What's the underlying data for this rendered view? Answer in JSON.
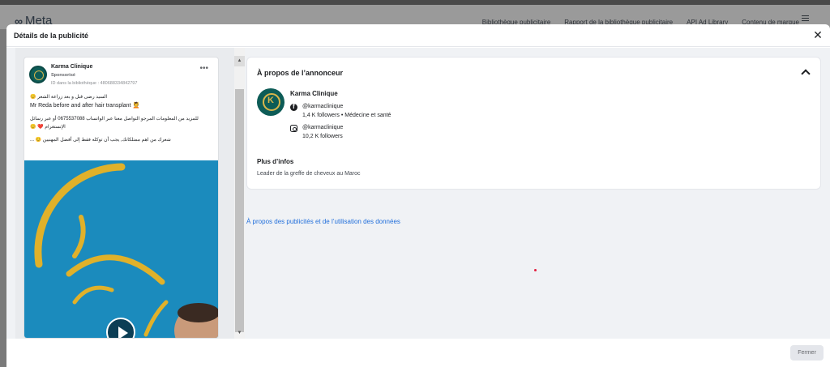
{
  "background": {
    "logo_word": "Meta",
    "nav": [
      "Bibliothèque publicitaire",
      "Rapport de la bibliothèque publicitaire",
      "API Ad Library",
      "Contenu de marque"
    ]
  },
  "modal": {
    "title": "Détails de la publicité",
    "close_label": "Fermer"
  },
  "ad": {
    "page_name": "Karma Clinique",
    "sponsored": "Sponsorisé",
    "library_id": "ID dans la bibliothèque : 480688334842797",
    "text_lines": [
      "السيد رضى قبل و بعد زراعة الشعر 😊",
      "Mr Reda before and after hair transplant 💆",
      "للمزيد من المعلومات المرجو التواصل معنا عبر الواتساب 0675537088 أو عبر رسائل الإنستغرام ❤️ 😊",
      "شعرك من اهم ممتلكاتك, يجب أن توكله فقط إلى أفضل المهنيين 😊 ..."
    ]
  },
  "advertiser": {
    "section_title": "À propos de l’annonceur",
    "name": "Karma Clinique",
    "facebook_handle": "@karmaclinique",
    "facebook_meta": "1,4 K followers • Médecine et santé",
    "instagram_handle": "@karmaclinique",
    "instagram_meta": "10,2 K followers",
    "more_info_title": "Plus d’infos",
    "more_info_text": "Leader de la greffe de cheveux au Maroc"
  },
  "links": {
    "about_ads": "À propos des publicités et de l’utilisation des données"
  },
  "colors": {
    "accent_link": "#216fdb",
    "brand_teal": "#0d5c57",
    "brand_gold": "#d9b64a",
    "media_blue": "#1b8bbd"
  }
}
